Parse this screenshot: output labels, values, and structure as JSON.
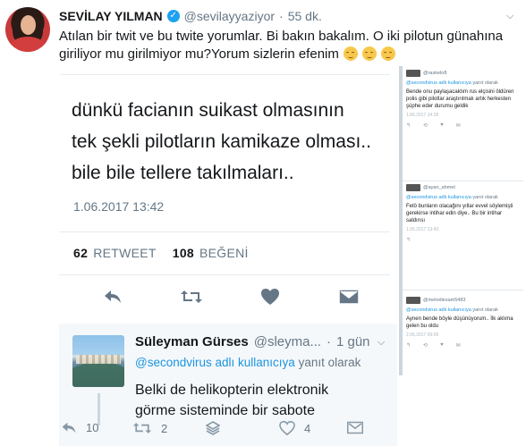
{
  "header": {
    "name": "SEVİLAY YILMAN",
    "handle": "@sevilayyaziyor",
    "separator": "·",
    "time": "55 dk.",
    "text": "Atılan bir twit ve bu twite yorumlar. Bi bakın bakalım. O iki pilotun günahına giriliyor mu girilmiyor mu?Yorum sizlerin efenim"
  },
  "embedded_tweet": {
    "body_lines": [
      "dünkü facianın suikast olmasının",
      "tek şekli pilotların kamikaze olması..",
      "bile bile tellere takılmaları.."
    ],
    "date": "1.06.2017 13:42",
    "retweet_count": "62",
    "retweet_label": "RETWEET",
    "like_count": "108",
    "like_label": "BEĞENİ"
  },
  "reply_tweet": {
    "name": "Süleyman Gürses",
    "handle": "@sleyma...",
    "separator": "·",
    "time": "1 gün",
    "reply_mention": "@secondvirus adlı kullanıcıya",
    "reply_suffix": "yanıt olarak",
    "text_lines": [
      "Belki de helikopterin elektronik",
      "görme sisteminde bir sabote"
    ]
  },
  "side_tweets": [
    {
      "handle": "@raskelo8",
      "reply_mention": "@secondvirus adlı kullanıcıya",
      "reply_suffix": "yanıt olarak",
      "text": "Bende onu paylaşacaktım rus elçisini öldüren polis gibi pilotlar araştırılmalı artık herkesten şüphe eder durumu geldik",
      "date": "1.06.2017 14:28"
    },
    {
      "handle": "@ayan_ahmet",
      "reply_mention": "@secondvirus adlı kullanıcıya",
      "reply_suffix": "yanıt olarak",
      "text": "Fetö bunların olacağını yıllar evvel söylemişti gerekirse intihar edin diye.. Bu bir intihar saldırısı",
      "date": "1.06.2017 13:43"
    },
    {
      "handle": "@melodiesam5483",
      "reply_mention": "@secondvirus adlı kullanıcıya",
      "reply_suffix": "yanıt olarak",
      "text": "Aynen bende böyle düşünüyorum.. İlk aklıma gelen bu oldu",
      "date": "2.06.2017 09:09"
    }
  ],
  "footer": {
    "reply_count": "10",
    "retweet_count": "2",
    "like_count": "4"
  },
  "colors": {
    "accent": "#1da1f2",
    "mention": "#1b95e0",
    "muted": "#657786",
    "like_heart": "#657786"
  }
}
